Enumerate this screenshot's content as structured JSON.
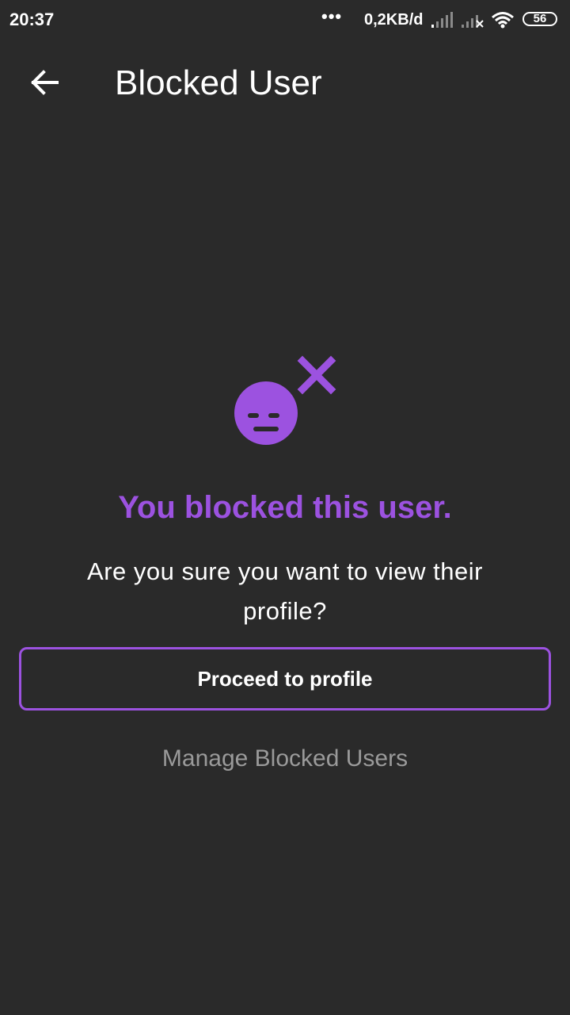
{
  "status_bar": {
    "time": "20:37",
    "dots": "•••",
    "data_speed": "0,2KB/d",
    "battery": "56",
    "icons": [
      "signal-icon",
      "signal-no-service-icon",
      "wifi-icon",
      "battery-icon"
    ]
  },
  "app_bar": {
    "title": "Blocked User",
    "back_icon": "arrow-left-icon"
  },
  "illustration": {
    "icon": "blocked-face-icon",
    "color": "#9c52e0"
  },
  "content": {
    "headline": "You blocked this user.",
    "question": "Are you sure you want to view their profile?",
    "proceed_label": "Proceed to profile",
    "manage_label": "Manage Blocked Users"
  },
  "colors": {
    "background": "#2a2a2a",
    "accent": "#9c52e0",
    "muted_text": "#9a9a9a"
  }
}
